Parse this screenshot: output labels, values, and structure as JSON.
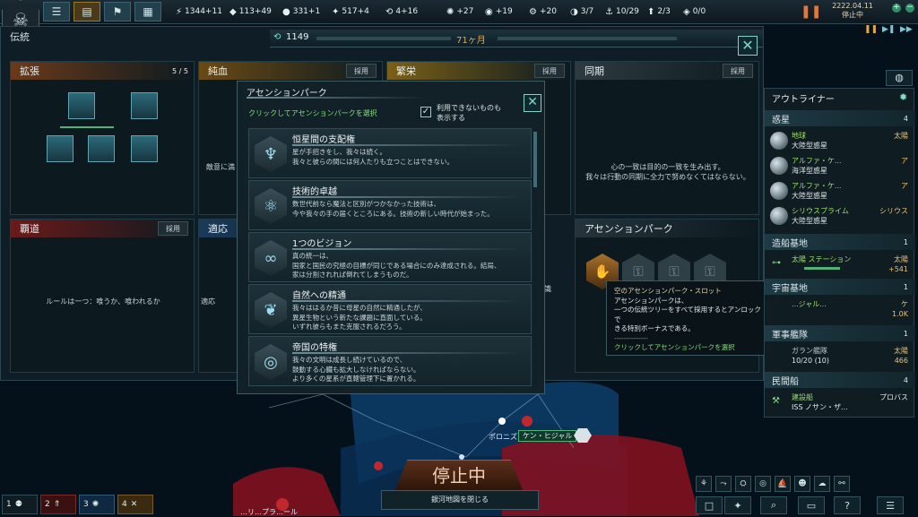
{
  "topbar": {
    "date": "2222.04.11",
    "status": "停止中",
    "resources": [
      {
        "icon": "energy-icon",
        "glyph": "⚡",
        "value": "1344+11"
      },
      {
        "icon": "minerals-icon",
        "glyph": "◆",
        "value": "113+49"
      },
      {
        "icon": "food-icon",
        "glyph": "●",
        "value": "331+1"
      },
      {
        "icon": "influence-icon",
        "glyph": "✦",
        "value": "517+4"
      },
      {
        "icon": "unity-icon",
        "glyph": "⟲",
        "value": "4+16"
      },
      {
        "icon": "research-icon",
        "glyph": "✺",
        "value": "+27"
      },
      {
        "icon": "society-icon",
        "glyph": "◉",
        "value": "+19"
      },
      {
        "icon": "engineering-icon",
        "glyph": "⚙",
        "value": "+20"
      },
      {
        "icon": "planets-icon",
        "glyph": "◑",
        "value": "3/7"
      },
      {
        "icon": "fleet-capacity-icon",
        "glyph": "⚓",
        "value": "10/29"
      },
      {
        "icon": "starbase-capacity-icon",
        "glyph": "⬆",
        "value": "2/3"
      },
      {
        "icon": "envoys-icon",
        "glyph": "◈",
        "value": "0/0"
      }
    ]
  },
  "traditions": {
    "title": "伝統",
    "unity": "1149",
    "months": "71ヶ月",
    "adopt_label": "採用",
    "trees": [
      {
        "name": "拡張",
        "count": "5 / 5",
        "desc": ""
      },
      {
        "name": "純血",
        "desc": "敵意に満"
      },
      {
        "name": "繁栄",
        "desc": ""
      },
      {
        "name": "同期",
        "desc": "心の一致は目的の一致を生み出す。\n我々は行動の同期に全力で努めなくてはならない。"
      },
      {
        "name": "覇道",
        "desc": "ルールは一つ：喰うか、喰われるか"
      },
      {
        "name": "適応",
        "desc": "適応"
      }
    ],
    "ascension_heading": "アセンションパーク",
    "partial_text_right": "識"
  },
  "ascension_popup": {
    "title": "アセンションパーク",
    "subtitle": "クリックしてアセンションパークを選択",
    "show_unavailable": "利用できないものも\n表示する",
    "perks": [
      {
        "name": "恒星間の支配権",
        "icon": "interstellar-dominion-icon",
        "glyph": "♆",
        "desc": "星が手招きをし、我々は続く。\n我々と彼らの間には何人たりも立つことはできない。"
      },
      {
        "name": "技術的卓越",
        "icon": "technological-ascendancy-icon",
        "glyph": "⚛",
        "desc": "数世代前なら魔法と区別がつかなかった技術は、\n今や我々の手の届くところにある。技術の新しい時代が始まった。"
      },
      {
        "name": "1つのビジョン",
        "icon": "one-vision-icon",
        "glyph": "∞",
        "desc": "真の統一は、\n国家と国民の究極の目標が同じである場合にのみ達成される。結局、\n家は分割されれば倒れてしまうものだ。"
      },
      {
        "name": "自然への精通",
        "icon": "mastery-of-nature-icon",
        "glyph": "❦",
        "desc": "我々ははるか昔に母星の自然に精通したが、\n異星生物という新たな課題に直面している。\nいずれ彼らもまた克服されるだろう。"
      },
      {
        "name": "帝国の特権",
        "icon": "imperial-prerogative-icon",
        "glyph": "◎",
        "desc": "我々の文明は成長し続けているので、\n鼓動する心臓も拡大しなければならない。\nより多くの星系が直轄管理下に置かれる。"
      }
    ]
  },
  "tooltip": {
    "title": "空のアセンションパーク・スロット",
    "body": "アセンションパークは、\n一つの伝統ツリーをすべて採用するとアンロックで\nきる特別ボーナスである。",
    "divider": "--------------",
    "action": "クリックしてアセンションパークを選択"
  },
  "outliner": {
    "title": "アウトライナー",
    "sections": [
      {
        "name": "惑星",
        "count": "4"
      },
      {
        "name": "造船基地",
        "count": "1"
      },
      {
        "name": "宇宙基地",
        "count": "1"
      },
      {
        "name": "軍事艦隊",
        "count": "1"
      },
      {
        "name": "民間船",
        "count": "4"
      }
    ],
    "planets": [
      {
        "name": "地球",
        "type": "大陸型惑星",
        "system": "太陽"
      },
      {
        "name": "アルファ・ケ...",
        "type": "海洋型惑星",
        "system": "ア"
      },
      {
        "name": "アルファ・ケ...",
        "type": "大陸型惑星",
        "system": "ア"
      },
      {
        "name": "シリウスプライム",
        "type": "大陸型惑星",
        "system": "シリウス"
      }
    ],
    "starbase": {
      "name": "太陽 ステーション",
      "system": "太陽",
      "value": "+541"
    },
    "outpost": {
      "name": "...ジャル...",
      "system": "ケ",
      "value": "1.0K"
    },
    "fleet": {
      "name": "ガラン艦隊",
      "system": "太陽",
      "strength": "10/20 (10)",
      "power": "466"
    },
    "civilian": {
      "name": "建設船",
      "sub": "ISS ノサン・ザ...",
      "system": "プロバス"
    }
  },
  "galaxy": {
    "system_label": "ポロニズ",
    "system_label2": "ケン・ヒジャル",
    "paused": "停止中",
    "close_map": "銀河地図を閉じる",
    "bottom_label": "…リ…プラ…ール"
  },
  "bottom_tabs": [
    {
      "num": "1",
      "icon": "planet-tab-icon",
      "glyph": "⚉"
    },
    {
      "num": "2",
      "icon": "rank-tab-icon",
      "glyph": "⇑"
    },
    {
      "num": "3",
      "icon": "research-tab-icon",
      "glyph": "✺"
    },
    {
      "num": "4",
      "icon": "tools-tab-icon",
      "glyph": "✕"
    }
  ]
}
